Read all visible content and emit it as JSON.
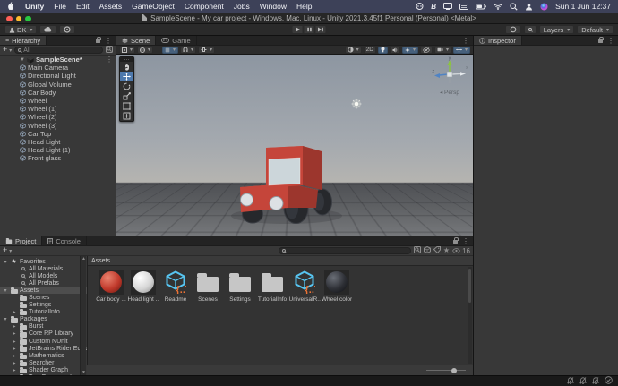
{
  "colors": {
    "menubar-bg": "#3d4158",
    "titlebar-bg": "#272727",
    "toolbar-bg": "#2a2a2a",
    "strip-bg": "#232323",
    "panel-bg": "#383838",
    "field-bg": "#2a2a2a",
    "text": "#c8c8c8",
    "accent-blue": "#4e79ad",
    "toggle-blue": "#46607c",
    "selection": "#4d4d4d",
    "traffic-red": "#ff5f57",
    "traffic-yellow": "#febc2e",
    "traffic-green": "#28c840",
    "car-red": "#c5453a",
    "car-red-dark": "#9c362d",
    "car-red-top": "#d35a4a",
    "glass": "#ccd6da",
    "wheel": "#26282c",
    "sky-top": "#8d96a1",
    "sky-horizon": "#b5b4b0",
    "ground-near": "#76787b",
    "ground-far": "#4e5054"
  },
  "menubar": {
    "app": "Unity",
    "items": [
      "File",
      "Edit",
      "Assets",
      "GameObject",
      "Component",
      "Jobs",
      "Window",
      "Help"
    ],
    "clock": "Sun 1 Jun 12:37"
  },
  "titlebar": {
    "title": "SampleScene - My car project - Windows, Mac, Linux - Unity 2021.3.45f1 Personal (Personal) <Metal>"
  },
  "toolbar": {
    "account": "DK",
    "layers": "Layers",
    "layout": "Default"
  },
  "hierarchy": {
    "tab": "Hierarchy",
    "create": "+",
    "search": "All",
    "scene_name": "SampleScene*",
    "items": [
      "Main Camera",
      "Directional Light",
      "Global Volume",
      "Car Body",
      "Wheel",
      "Wheel (1)",
      "Wheel (2)",
      "Wheel (3)",
      "Car Top",
      "Head Light",
      "Head Light (1)",
      "Front glass"
    ]
  },
  "scene": {
    "tab_scene": "Scene",
    "tab_game": "Game",
    "btn_2d": "2D",
    "persp": "Persp",
    "axis": {
      "x": "x",
      "y": "y",
      "z": "z"
    }
  },
  "inspector": {
    "tab": "Inspector"
  },
  "project": {
    "tab_project": "Project",
    "tab_console": "Console",
    "create": "+",
    "hidden_count": "16",
    "breadcrumb": "Assets",
    "tree": [
      {
        "label": "Favorites",
        "icon": "star",
        "level": 0,
        "exp": "open"
      },
      {
        "label": "All Materials",
        "icon": "search",
        "level": 1,
        "exp": "none"
      },
      {
        "label": "All Models",
        "icon": "search",
        "level": 1,
        "exp": "none"
      },
      {
        "label": "All Prefabs",
        "icon": "search",
        "level": 1,
        "exp": "none"
      },
      {
        "label": "Assets",
        "icon": "folder-open",
        "level": 0,
        "exp": "open",
        "selected": true
      },
      {
        "label": "Scenes",
        "icon": "folder",
        "level": 1,
        "exp": "none"
      },
      {
        "label": "Settings",
        "icon": "folder",
        "level": 1,
        "exp": "none"
      },
      {
        "label": "TutorialInfo",
        "icon": "folder",
        "level": 1,
        "exp": "closed"
      },
      {
        "label": "Packages",
        "icon": "folder-open",
        "level": 0,
        "exp": "open"
      },
      {
        "label": "Burst",
        "icon": "folder",
        "level": 1,
        "exp": "closed"
      },
      {
        "label": "Core RP Library",
        "icon": "folder",
        "level": 1,
        "exp": "closed"
      },
      {
        "label": "Custom NUnit",
        "icon": "folder",
        "level": 1,
        "exp": "closed"
      },
      {
        "label": "JetBrains Rider Editor",
        "icon": "folder",
        "level": 1,
        "exp": "closed"
      },
      {
        "label": "Mathematics",
        "icon": "folder",
        "level": 1,
        "exp": "closed"
      },
      {
        "label": "Searcher",
        "icon": "folder",
        "level": 1,
        "exp": "closed"
      },
      {
        "label": "Shader Graph",
        "icon": "folder",
        "level": 1,
        "exp": "closed"
      },
      {
        "label": "Test Framework",
        "icon": "folder",
        "level": 1,
        "exp": "closed"
      }
    ],
    "assets": [
      {
        "label": "Car body ...",
        "kind": "sphere-red"
      },
      {
        "label": "Head light ...",
        "kind": "sphere-white"
      },
      {
        "label": "Readme",
        "kind": "script"
      },
      {
        "label": "Scenes",
        "kind": "folder"
      },
      {
        "label": "Settings",
        "kind": "folder"
      },
      {
        "label": "TutorialInfo",
        "kind": "folder"
      },
      {
        "label": "UniversalR...",
        "kind": "script"
      },
      {
        "label": "Wheel color",
        "kind": "sphere-dark"
      }
    ]
  }
}
